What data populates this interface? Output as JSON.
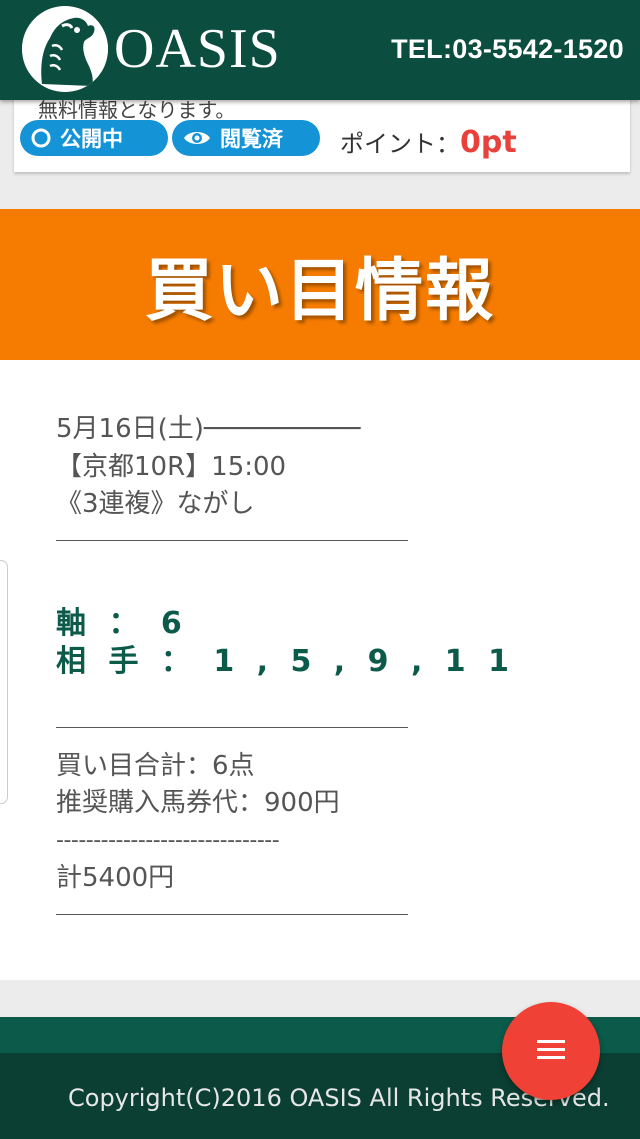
{
  "header": {
    "logo_text": "OASIS",
    "tel": "TEL:03-5542-1520"
  },
  "info_card": {
    "free_text": "無料情報となります。",
    "badge_open": "公開中",
    "badge_viewed": "閲覧済",
    "points_label": "ポイント：",
    "points_value": "0pt"
  },
  "title": "買い目情報",
  "race": {
    "date": "5月16日(土)──────────",
    "venue": "【京都10R】15:00",
    "bet_type": "《3連複》ながし"
  },
  "picks": {
    "axis": "軸 ： 6",
    "partners": "相 手 ： 1 , 5 , 9 , 1 1"
  },
  "summary": {
    "total_points": "買い目合計：6点",
    "recommended": "推奨購入馬券代：900円",
    "dashes": "------------------------------",
    "total": "計5400円"
  },
  "footer": {
    "copyright": "Copyright(C)2016 OASIS All Rights Reserved."
  },
  "icons": [
    "horse-logo-icon",
    "circle-icon",
    "eye-icon",
    "menu-icon"
  ],
  "colors": {
    "header": "#0b4d3e",
    "title_band": "#f57c00",
    "badge": "#1493d6",
    "points": "#e8403a",
    "fab": "#ef4136",
    "picks": "#0b5a4a"
  }
}
